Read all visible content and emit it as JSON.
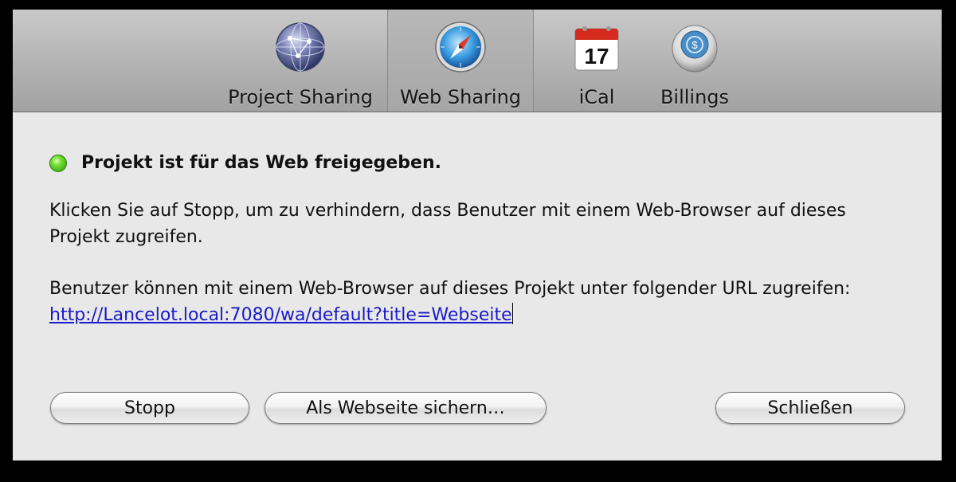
{
  "toolbar": {
    "items": [
      {
        "label": "Project Sharing",
        "icon": "globe-icon"
      },
      {
        "label": "Web Sharing",
        "icon": "safari-compass-icon",
        "selected": true
      },
      {
        "label": "iCal",
        "icon": "calendar-icon",
        "calendar_day": "17"
      },
      {
        "label": "Billings",
        "icon": "billings-icon"
      }
    ]
  },
  "status": {
    "text": "Projekt ist für das Web freigegeben.",
    "color": "#4cc21f"
  },
  "message1": "Klicken Sie auf Stopp, um zu verhindern, dass Benutzer mit einem Web-Browser auf dieses Projekt zugreifen.",
  "message2": {
    "text": "Benutzer können mit einem Web-Browser auf dieses Projekt unter folgender URL zugreifen: ",
    "url": "http://Lancelot.local:7080/wa/default?title=Webseite"
  },
  "buttons": {
    "stop": "Stopp",
    "save_as_webpage": "Als Webseite sichern…",
    "close": "Schließen"
  }
}
